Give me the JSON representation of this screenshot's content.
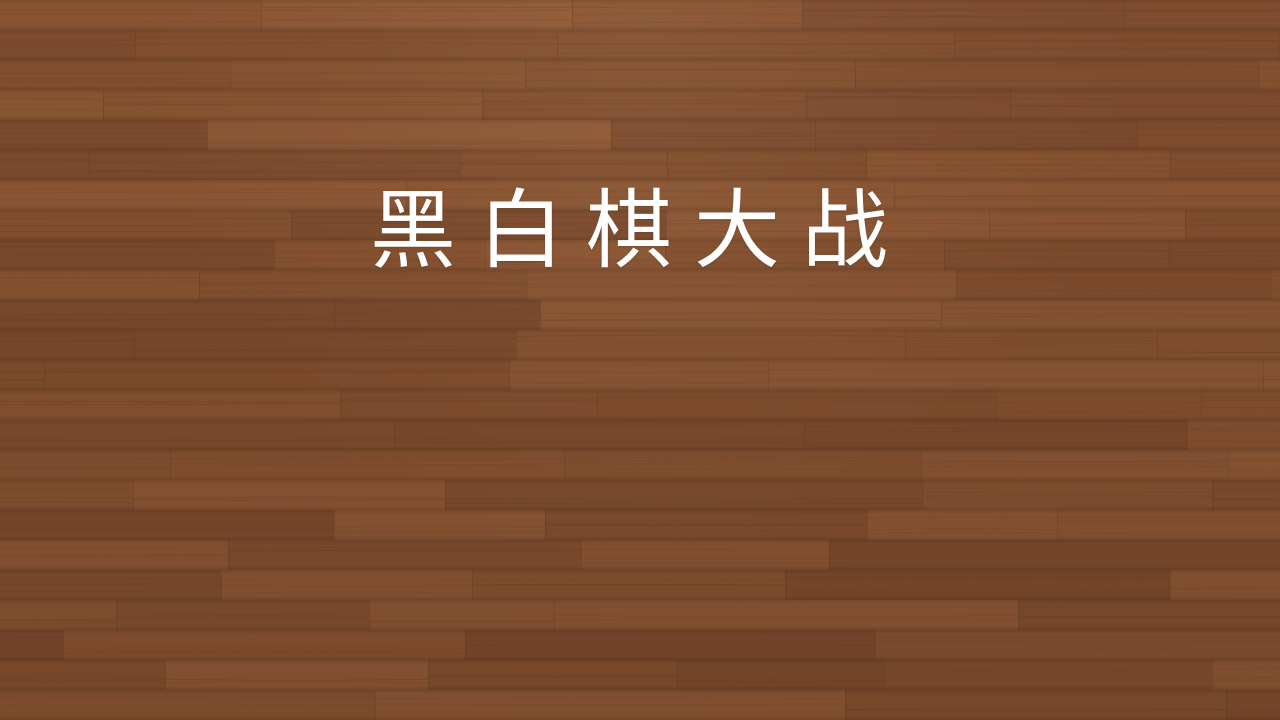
{
  "title": "黑白棋大战",
  "colors": {
    "background": "#7a4a2b",
    "title_text": "#ffffff"
  }
}
